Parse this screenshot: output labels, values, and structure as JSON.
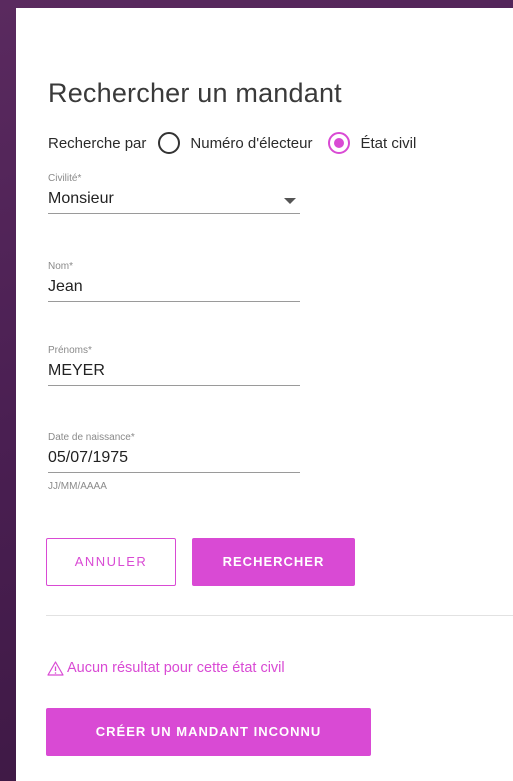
{
  "page": {
    "title": "Rechercher un mandant"
  },
  "search_by": {
    "label": "Recherche par",
    "options": [
      {
        "label": "Numéro d'électeur",
        "selected": false
      },
      {
        "label": "État civil",
        "selected": true
      }
    ]
  },
  "form": {
    "civility": {
      "label": "Civilité*",
      "value": "Monsieur"
    },
    "last_name": {
      "label": "Nom*",
      "value": "Jean"
    },
    "first_names": {
      "label": "Prénoms*",
      "value": "MEYER"
    },
    "birth_date": {
      "label": "Date de naissance*",
      "value": "05/07/1975",
      "hint": "JJ/MM/AAAA"
    }
  },
  "actions": {
    "cancel_label": "ANNULER",
    "search_label": "RECHERCHER"
  },
  "result": {
    "warning_text": "Aucun résultat pour cette état civil",
    "create_label": "CRÉER UN MANDANT INCONNU"
  },
  "colors": {
    "accent": "#d94ad4",
    "background": "#4a1f52",
    "card": "#ffffff"
  }
}
